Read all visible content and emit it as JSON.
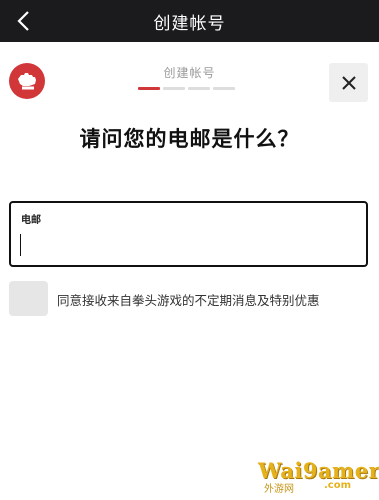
{
  "topbar": {
    "title": "创建帐号"
  },
  "step": {
    "label": "创建帐号",
    "total": 4,
    "current": 1
  },
  "question": "请问您的电邮是什么？",
  "email": {
    "label": "电邮",
    "value": ""
  },
  "consent": {
    "label": "同意接收来自拳头游戏的不定期消息及特别优惠",
    "checked": false
  },
  "watermark": {
    "main": "Wai9amer",
    "sub": "外游网",
    "domain": ".com"
  },
  "colors": {
    "accent": "#d13639",
    "topbar_bg": "#1b1b1d",
    "watermark": "#e6b21c"
  },
  "icons": {
    "back": "chevron-left-icon",
    "close": "close-icon",
    "logo": "riot-fist-logo"
  }
}
